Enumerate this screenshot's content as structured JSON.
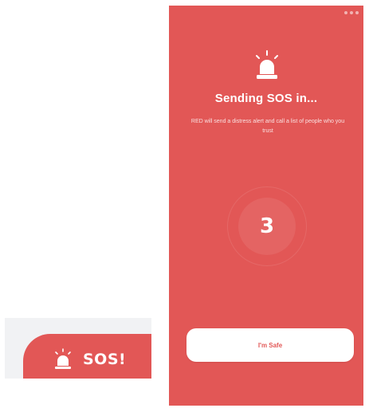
{
  "sos_tab": {
    "label": "SOS!",
    "icon": "siren-icon"
  },
  "sos_screen": {
    "title": "Sending SOS in...",
    "subtitle": "RED will send a distress alert and call a list of people who you trust",
    "countdown": "3",
    "button_label": "I'm Safe",
    "icon": "siren-icon"
  },
  "colors": {
    "accent": "#e25756",
    "background": "#ffffff",
    "card": "#f1f2f4"
  }
}
